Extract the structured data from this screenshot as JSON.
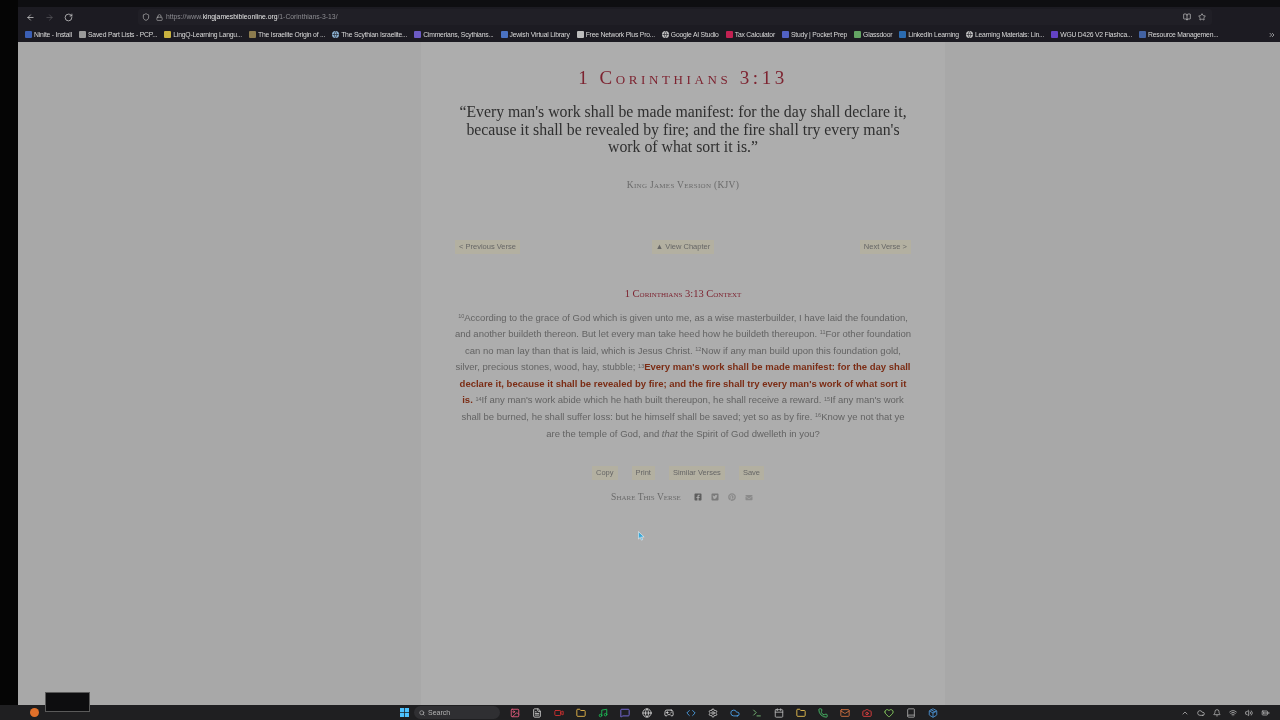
{
  "browser": {
    "forward_disabled": true,
    "url": {
      "scheme": "https://www.",
      "domain": "kingjamesbibleonline.org",
      "path": "/1-Corinthians-3-13/"
    },
    "bookmarks": [
      {
        "label": "Ninite - Install",
        "kind": "site",
        "color": "#3b5fb5"
      },
      {
        "label": "Saved Part Lists - PCP...",
        "kind": "site",
        "color": "#9a9a9a"
      },
      {
        "label": "LingQ-Learning Langu...",
        "kind": "site",
        "color": "#c9b23f"
      },
      {
        "label": "The Israelite Origin of ...",
        "kind": "site",
        "color": "#8c7b4e"
      },
      {
        "label": "The Scythian Israelite...",
        "kind": "globe",
        "color": "#8fb6d6"
      },
      {
        "label": "Cimmerians, Scythians...",
        "kind": "site",
        "color": "#6c5bc4"
      },
      {
        "label": "Jewish Virtual Library",
        "kind": "site",
        "color": "#4a72c2"
      },
      {
        "label": "Free Network Plus Pro...",
        "kind": "site",
        "color": "#bdbdbd"
      },
      {
        "label": "Google AI Studio",
        "kind": "globe",
        "color": "#c4c4c4"
      },
      {
        "label": "Tax Calculator",
        "kind": "site",
        "color": "#c22152"
      },
      {
        "label": "Study | Pocket Prep",
        "kind": "site",
        "color": "#5262c4"
      },
      {
        "label": "Glassdoor",
        "kind": "site",
        "color": "#63a463"
      },
      {
        "label": "LinkedIn Learning",
        "kind": "site",
        "color": "#2b6cb2"
      },
      {
        "label": "Learning Materials: Lin...",
        "kind": "globe",
        "color": "#c4c4c4"
      },
      {
        "label": "WGU D426 V2 Flashca...",
        "kind": "site",
        "color": "#6343c4"
      },
      {
        "label": "Resource Managemen...",
        "kind": "site",
        "color": "#4363a3"
      }
    ]
  },
  "page": {
    "title": "1 Corinthians 3:13",
    "quote": "“Every man's work shall be made manifest: for the day shall declare it, because it shall be revealed by fire; and the fire shall try every man's work of what sort it is.”",
    "version": "King James Version (KJV)",
    "verse_nav": [
      "< Previous Verse",
      "▲ View Chapter",
      "Next Verse >"
    ],
    "context_title": "1 Corinthians 3:13 Context",
    "context": "$^{10}$According to the grace of God which is given unto me, as a wise masterbuilder, I have laid the foundation, and another buildeth thereon. But let every man take heed how he buildeth thereupon. $^{11}$For other foundation can no man lay than that is laid, which is Jesus Christ. $^{12}$Now if any man build upon this foundation gold, silver, precious stones, wood, hay, stubble; $^{13}$**Every man's work shall be made manifest: for the day shall declare it, because it shall be revealed by fire; and the fire shall try every man's work of what sort it is.** $^{14}$If any man's work abide which he hath built thereupon, he shall receive a reward. $^{15}$If any man's work shall be burned, he shall suffer loss: but he himself shall be saved; yet so as by fire. $^{16}$Know ye not that ye are the temple of God, and *that* the Spirit of God dwelleth in you?",
    "actions": [
      "Copy",
      "Print",
      "Similar Verses",
      "Save"
    ],
    "share_label": "Share This Verse"
  },
  "taskbar": {
    "search_placeholder": "Search"
  }
}
